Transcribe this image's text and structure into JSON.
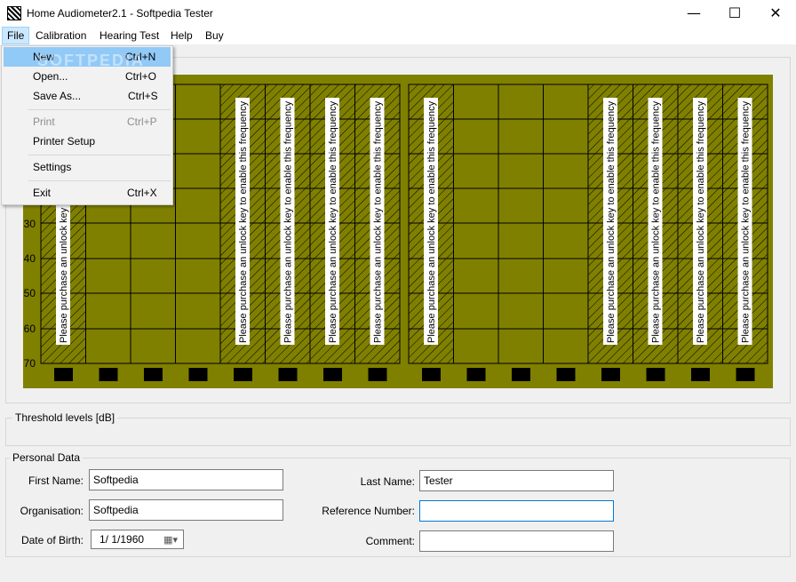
{
  "window": {
    "title": "Home Audiometer2.1 - Softpedia Tester",
    "minimize_glyph": "—",
    "maximize_glyph": "☐",
    "close_glyph": "✕"
  },
  "menu": {
    "items": [
      "File",
      "Calibration",
      "Hearing Test",
      "Help",
      "Buy"
    ]
  },
  "file_menu": {
    "watermark": "SOFTPEDIA",
    "items": [
      {
        "label": "New",
        "shortcut": "Ctrl+N"
      },
      {
        "label": "Open...",
        "shortcut": "Ctrl+O"
      },
      {
        "label": "Save As...",
        "shortcut": "Ctrl+S"
      },
      {
        "label": "Print",
        "shortcut": "Ctrl+P"
      },
      {
        "label": "Printer Setup",
        "shortcut": ""
      },
      {
        "label": "Settings",
        "shortcut": ""
      },
      {
        "label": "Exit",
        "shortcut": "Ctrl+X"
      }
    ]
  },
  "chart": {
    "y_ticks": [
      "30",
      "40",
      "50",
      "60",
      "70"
    ],
    "locked_message": "Please purchase an unlock key to enable this frequency",
    "left_columns_locked": [
      true,
      false,
      false,
      false,
      true,
      true,
      true,
      true
    ],
    "right_columns_locked": [
      true,
      false,
      false,
      false,
      true,
      true,
      true,
      true
    ],
    "panel_color": "#808000",
    "grid_color": "#000000"
  },
  "threshold": {
    "label": "Threshold levels [dB]"
  },
  "personal": {
    "label": "Personal Data",
    "first_name_label": "First Name:",
    "first_name": "Softpedia",
    "organisation_label": "Organisation:",
    "organisation": "Softpedia",
    "dob_label": "Date of Birth:",
    "dob": "1/  1/1960",
    "last_name_label": "Last Name:",
    "last_name": "Tester",
    "reference_label": "Reference Number:",
    "reference": "",
    "comment_label": "Comment:",
    "comment": ""
  }
}
